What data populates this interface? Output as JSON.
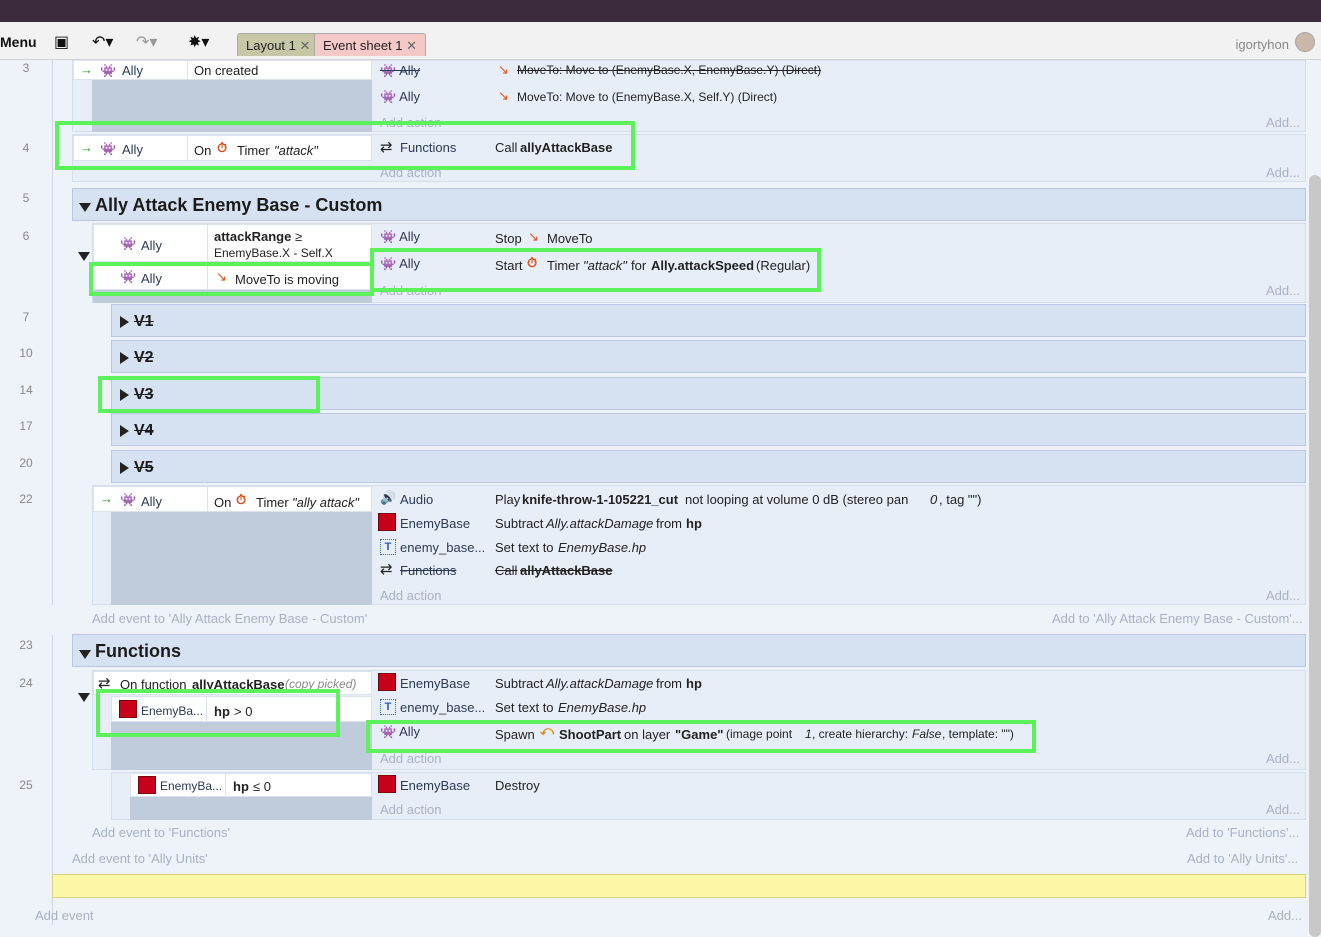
{
  "toolbar": {
    "menu_label": "Menu",
    "tabs": [
      {
        "label": "Layout 1"
      },
      {
        "label": "Event sheet 1"
      }
    ],
    "username": "igortyhon"
  },
  "gutter": [
    "3",
    "4",
    "5",
    "6",
    "7",
    "10",
    "14",
    "17",
    "20",
    "22",
    "23",
    "24",
    "25"
  ],
  "ev3": {
    "cond_obj": "Ally",
    "cond_text": "On created",
    "act1_obj": "Ally",
    "act1_text": "MoveTo: Move to (EnemyBase.X, EnemyBase.Y) (Direct)",
    "act2_obj": "Ally",
    "act2_text": "MoveTo: Move to (EnemyBase.X, Self.Y) (Direct)",
    "add_action": "Add action",
    "add": "Add..."
  },
  "ev4": {
    "cond_obj": "Ally",
    "cond_on": "On",
    "cond_timer": "Timer",
    "cond_name": "\"attack\"",
    "act_obj": "Functions",
    "act_verb": "Call",
    "act_fn": "allyAttackBase",
    "add_action": "Add action",
    "add": "Add..."
  },
  "group1": {
    "title": "Ally Attack Enemy Base - Custom"
  },
  "ev6": {
    "c1_obj": "Ally",
    "c1_b": "attackRange",
    "c1_op": "≥",
    "c1_rest": "EnemyBase.X - Self.X",
    "c2_obj": "Ally",
    "c2_text": "MoveTo is moving",
    "a1_obj": "Ally",
    "a1_verb": "Stop",
    "a1_beh": "MoveTo",
    "a2_obj": "Ally",
    "a2_start": "Start",
    "a2_timer": "Timer",
    "a2_name": "\"attack\"",
    "a2_for": "for",
    "a2_speed": "Ally.attackSpeed",
    "a2_mode": "(Regular)",
    "add_action": "Add action",
    "add": "Add..."
  },
  "subgroups": [
    {
      "title": "V1"
    },
    {
      "title": "V2"
    },
    {
      "title": "V3"
    },
    {
      "title": "V4"
    },
    {
      "title": "V5"
    }
  ],
  "ev22": {
    "cond_obj": "Ally",
    "cond_on": "On",
    "cond_timer": "Timer",
    "cond_name": "\"ally attack\"",
    "a1_obj": "Audio",
    "a1_verb": "Play",
    "a1_file": "knife-throw-1-105221_cut",
    "a1_rest": "not looping at volume 0 dB (stereo pan",
    "a1_pan": "0",
    "a1_tag": ", tag \"\")",
    "a2_obj": "EnemyBase",
    "a2_verb": "Subtract",
    "a2_expr": "Ally.attackDamage",
    "a2_from": "from",
    "a2_var": "hp",
    "a3_obj": "enemy_base...",
    "a3_verb": "Set text to",
    "a3_expr": "EnemyBase.hp",
    "a4_obj": "Functions",
    "a4_verb": "Call",
    "a4_fn": "allyAttackBase",
    "add_action": "Add action",
    "add": "Add..."
  },
  "group1_add": {
    "left": "Add event to 'Ally Attack Enemy Base - Custom'",
    "right": "Add to 'Ally Attack Enemy Base - Custom'..."
  },
  "group2": {
    "title": "Functions"
  },
  "ev24": {
    "cond_on": "On function",
    "cond_fn": "allyAttackBase",
    "cond_note": "(copy picked)",
    "c2_obj": "EnemyBa...",
    "c2_var": "hp",
    "c2_rest": "> 0",
    "a1_obj": "EnemyBase",
    "a1_verb": "Subtract",
    "a1_expr": "Ally.attackDamage",
    "a1_from": "from",
    "a1_var": "hp",
    "a2_obj": "enemy_base...",
    "a2_verb": "Set text to",
    "a2_expr": "EnemyBase.hp",
    "a3_obj": "Ally",
    "a3_verb": "Spawn",
    "a3_name": "ShootPart",
    "a3_onlayer": "on layer",
    "a3_layer": "\"Game\"",
    "a3_rest1": "(image point",
    "a3_pt": "1",
    "a3_rest2": ", create hierarchy:",
    "a3_hier": "False",
    "a3_rest3": ", template: \"\")",
    "add_action": "Add action",
    "add": "Add..."
  },
  "ev25": {
    "c_obj": "EnemyBa...",
    "c_var": "hp",
    "c_rest": "≤ 0",
    "a_obj": "EnemyBase",
    "a_text": "Destroy",
    "add_action": "Add action",
    "add": "Add..."
  },
  "group2_add": {
    "left": "Add event to 'Functions'",
    "right": "Add to 'Functions'..."
  },
  "outer_add": {
    "left": "Add event to 'Ally Units'",
    "right": "Add to 'Ally Units'..."
  },
  "bottom": {
    "left": "Add event",
    "right": "Add..."
  }
}
